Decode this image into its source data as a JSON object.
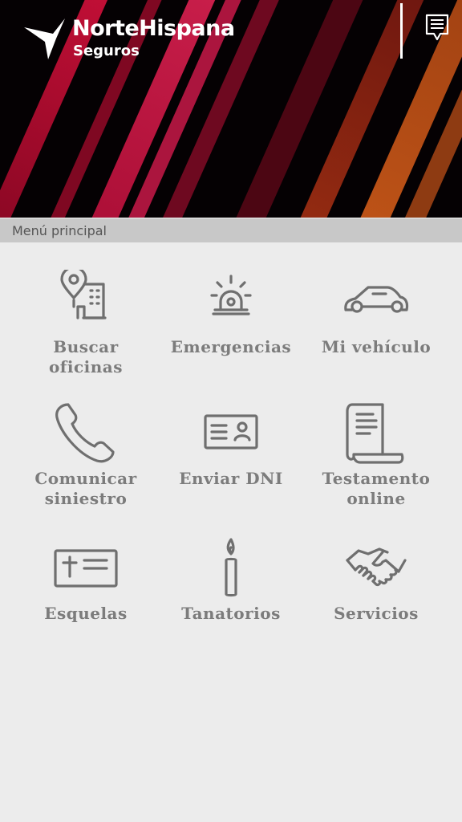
{
  "header": {
    "brand_name": "NorteHispana",
    "brand_sub": "Seguros",
    "logo_icon": "northispana-logo-mark",
    "menu_icon": "menu-list-icon"
  },
  "section": {
    "title": "Menú principal"
  },
  "tiles": [
    {
      "label": "Buscar\noficinas",
      "icon": "location-building-icon"
    },
    {
      "label": "Emergencias",
      "icon": "siren-icon"
    },
    {
      "label": "Mi vehículo",
      "icon": "car-icon"
    },
    {
      "label": "Comunicar\nsiniestro",
      "icon": "phone-icon"
    },
    {
      "label": "Enviar DNI",
      "icon": "id-card-icon"
    },
    {
      "label": "Testamento\nonline",
      "icon": "document-scroll-icon"
    },
    {
      "label": "Esquelas",
      "icon": "obituary-card-icon"
    },
    {
      "label": "Tanatorios",
      "icon": "candle-icon"
    },
    {
      "label": "Servicios",
      "icon": "handshake-icon"
    }
  ],
  "colors": {
    "header_bg": "#050103",
    "streak_red": "#d4103a",
    "streak_orange": "#e2571a",
    "section_bar": "#c8c8c8",
    "page_bg": "#ececec",
    "icon_gray": "#6f6f6f",
    "label_gray": "#7c7c7c"
  }
}
